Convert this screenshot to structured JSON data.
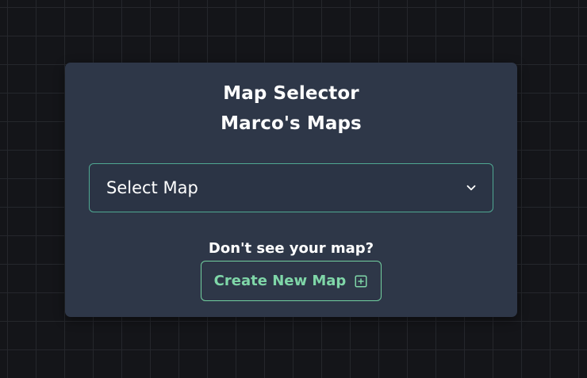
{
  "card": {
    "title": "Map Selector",
    "subtitle": "Marco's Maps"
  },
  "select": {
    "value": "Select Map",
    "icon": "chevron-down-icon"
  },
  "create": {
    "prompt": "Don't see your map?",
    "button_label": "Create New Map",
    "icon": "plus-square-icon"
  },
  "colors": {
    "background": "#141519",
    "card": "#2e3748",
    "select_border": "#4fa792",
    "accent_green": "#7fd6a8"
  }
}
